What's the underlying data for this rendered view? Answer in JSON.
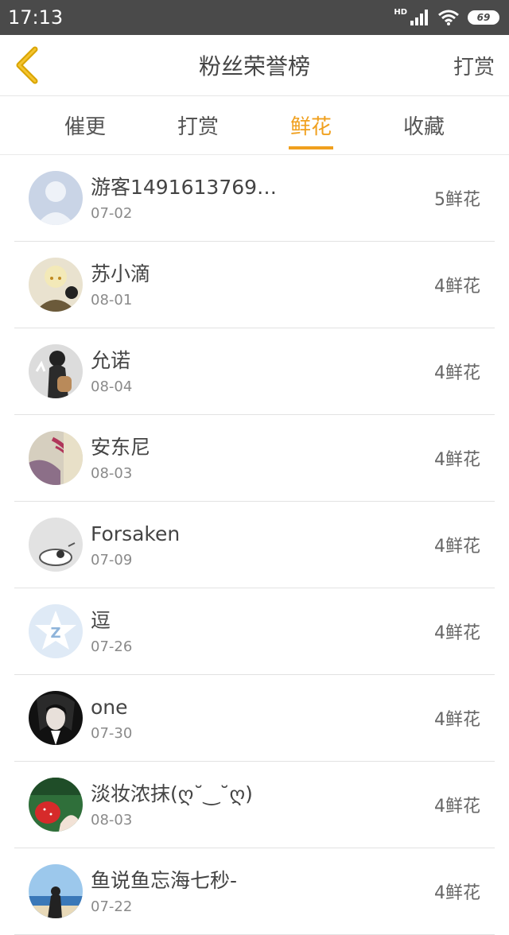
{
  "status": {
    "time": "17:13",
    "hd": "HD",
    "battery": "69"
  },
  "header": {
    "title": "粉丝荣誉榜",
    "action": "打赏"
  },
  "tabs": [
    {
      "label": "催更"
    },
    {
      "label": "打赏"
    },
    {
      "label": "鲜花"
    },
    {
      "label": "收藏"
    }
  ],
  "active_tab": "鲜花",
  "accent_color": "#f0a01e",
  "fans": [
    {
      "name": "游客1491613769…",
      "date": "07-02",
      "count": "5鲜花"
    },
    {
      "name": "苏小滴",
      "date": "08-01",
      "count": "4鲜花"
    },
    {
      "name": "允诺",
      "date": "08-04",
      "count": "4鲜花"
    },
    {
      "name": "安东尼",
      "date": "08-03",
      "count": "4鲜花"
    },
    {
      "name": "Forsaken",
      "date": "07-09",
      "count": "4鲜花"
    },
    {
      "name": "逗",
      "date": "07-26",
      "count": "4鲜花"
    },
    {
      "name": "one",
      "date": "07-30",
      "count": "4鲜花"
    },
    {
      "name": "淡妆浓抹(ღ˘‿˘ღ)",
      "date": "08-03",
      "count": "4鲜花"
    },
    {
      "name": "鱼说鱼忘海七秒-",
      "date": "07-22",
      "count": "4鲜花"
    }
  ]
}
